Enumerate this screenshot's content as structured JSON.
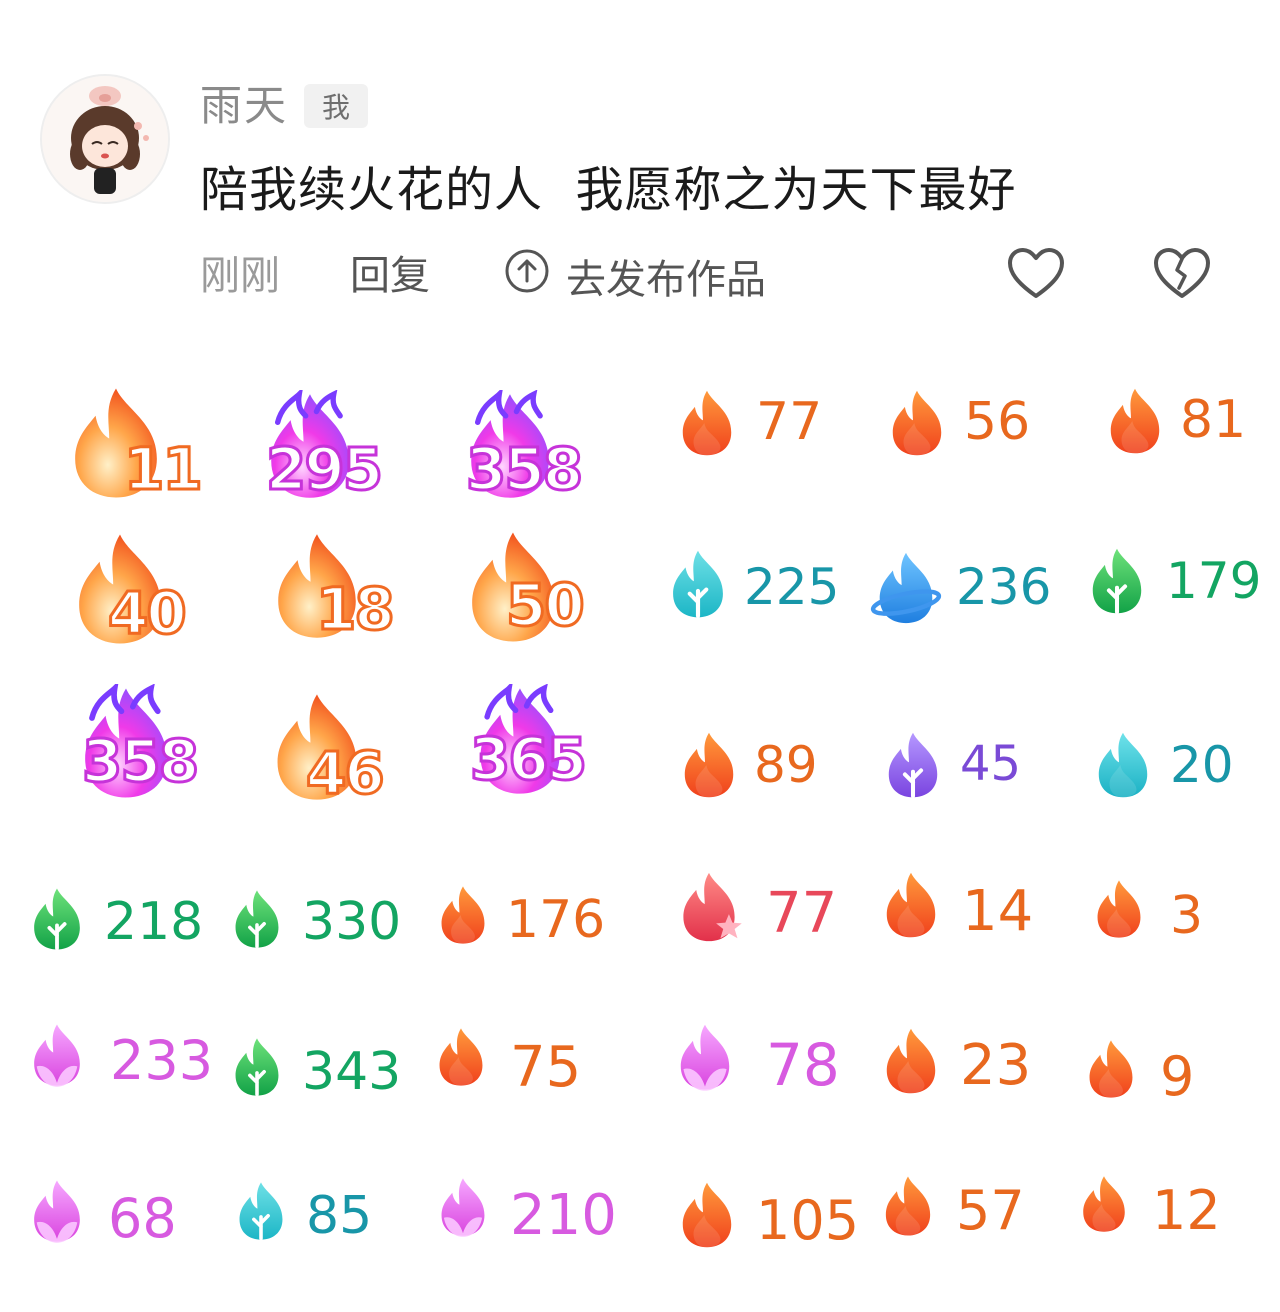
{
  "comment": {
    "username": "雨天",
    "me_badge": "我",
    "text": "陪我续火花的人  我愿称之为天下最好",
    "time": "刚刚",
    "reply_label": "回复",
    "publish_label": "去发布作品",
    "icons": {
      "publish": "arrow-up-circle-icon",
      "like": "heart-outline-icon",
      "dislike": "broken-heart-icon"
    }
  },
  "colors": {
    "orange_flame": "#f25a1e",
    "orange_text": "#e8681e",
    "pink_flame": "#e146e6",
    "pink_text": "#d75ae0",
    "green_leaf": "#1fae4f",
    "green_text": "#13a562",
    "teal_flame": "#23b9c9",
    "teal_text": "#1896a8",
    "blue_flame": "#2d8fe6",
    "purple_flame": "#8757e6",
    "purple_text": "#7a4ad6",
    "red_star_flame": "#f0485a",
    "red_text": "#e8485a"
  },
  "streaks_big": [
    {
      "value": "11",
      "style": "orange-flame"
    },
    {
      "value": "295",
      "style": "magenta-flame"
    },
    {
      "value": "358",
      "style": "magenta-flame"
    },
    {
      "value": "40",
      "style": "orange-flame"
    },
    {
      "value": "18",
      "style": "orange-flame"
    },
    {
      "value": "50",
      "style": "orange-flame"
    },
    {
      "value": "358",
      "style": "magenta-flame"
    },
    {
      "value": "46",
      "style": "orange-flame"
    },
    {
      "value": "365",
      "style": "magenta-flame"
    }
  ],
  "streaks": [
    {
      "value": "77",
      "icon": "orange-flame-icon"
    },
    {
      "value": "56",
      "icon": "orange-flame-icon"
    },
    {
      "value": "81",
      "icon": "orange-flame-icon"
    },
    {
      "value": "225",
      "icon": "teal-leaf-flame-icon"
    },
    {
      "value": "236",
      "icon": "blue-planet-flame-icon"
    },
    {
      "value": "179",
      "icon": "green-leaf-flame-icon"
    },
    {
      "value": "89",
      "icon": "orange-flame-icon"
    },
    {
      "value": "45",
      "icon": "purple-leaf-flame-icon"
    },
    {
      "value": "20",
      "icon": "teal-flame-icon"
    },
    {
      "value": "218",
      "icon": "green-leaf-flame-icon"
    },
    {
      "value": "330",
      "icon": "green-leaf-flame-icon"
    },
    {
      "value": "176",
      "icon": "orange-flame-icon"
    },
    {
      "value": "77",
      "icon": "red-star-flame-icon"
    },
    {
      "value": "14",
      "icon": "orange-flame-icon"
    },
    {
      "value": "3",
      "icon": "orange-flame-icon"
    },
    {
      "value": "233",
      "icon": "pink-petal-flame-icon"
    },
    {
      "value": "343",
      "icon": "green-leaf-flame-icon"
    },
    {
      "value": "75",
      "icon": "orange-flame-icon"
    },
    {
      "value": "78",
      "icon": "pink-petal-flame-icon"
    },
    {
      "value": "23",
      "icon": "orange-flame-icon"
    },
    {
      "value": "9",
      "icon": "orange-flame-icon"
    },
    {
      "value": "68",
      "icon": "pink-petal-flame-icon"
    },
    {
      "value": "85",
      "icon": "teal-leaf-flame-icon"
    },
    {
      "value": "210",
      "icon": "pink-petal-flame-icon"
    },
    {
      "value": "105",
      "icon": "orange-flame-icon"
    },
    {
      "value": "57",
      "icon": "orange-flame-icon"
    },
    {
      "value": "12",
      "icon": "orange-flame-icon"
    }
  ]
}
